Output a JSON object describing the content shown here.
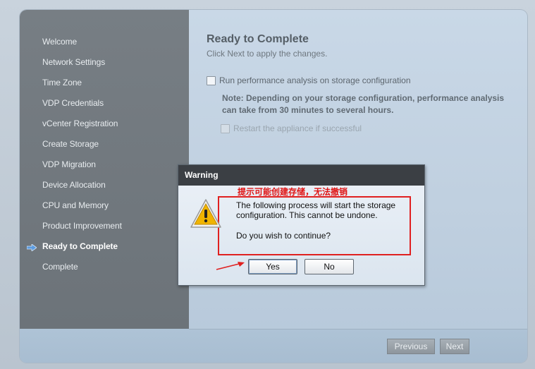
{
  "sidebar": {
    "items": [
      {
        "label": "Welcome",
        "active": false
      },
      {
        "label": "Network Settings",
        "active": false
      },
      {
        "label": "Time Zone",
        "active": false
      },
      {
        "label": "VDP Credentials",
        "active": false
      },
      {
        "label": "vCenter Registration",
        "active": false
      },
      {
        "label": "Create Storage",
        "active": false
      },
      {
        "label": "VDP Migration",
        "active": false
      },
      {
        "label": "Device Allocation",
        "active": false
      },
      {
        "label": "CPU and Memory",
        "active": false
      },
      {
        "label": "Product Improvement",
        "active": false
      },
      {
        "label": "Ready to Complete",
        "active": true
      },
      {
        "label": "Complete",
        "active": false
      }
    ],
    "active_indicator_icon": "right-arrow-icon"
  },
  "main": {
    "title": "Ready to Complete",
    "subtitle": "Click Next to apply the changes.",
    "option_perf": {
      "label": "Run performance analysis on storage configuration",
      "checked": false
    },
    "note": "Note: Depending on your storage configuration, performance analysis can take from 30 minutes to several hours.",
    "option_restart": {
      "label": "Restart the appliance if successful",
      "checked": false,
      "disabled": true
    }
  },
  "footer": {
    "previous_label": "Previous",
    "next_label": "Next"
  },
  "dialog": {
    "title": "Warning",
    "icon": "warning-triangle-icon",
    "message_line1": "The following process will start the storage",
    "message_line2": "configuration.  This cannot be undone.",
    "question": "Do you wish to continue?",
    "yes_label": "Yes",
    "no_label": "No"
  },
  "annotation": {
    "text": "提示可能创建存储，无法撤销",
    "color": "#e01515"
  },
  "colors": {
    "sidebar_bg": "#727980",
    "dialog_titlebar": "#3b3f44",
    "accent_arrow": "#4a90e2"
  }
}
